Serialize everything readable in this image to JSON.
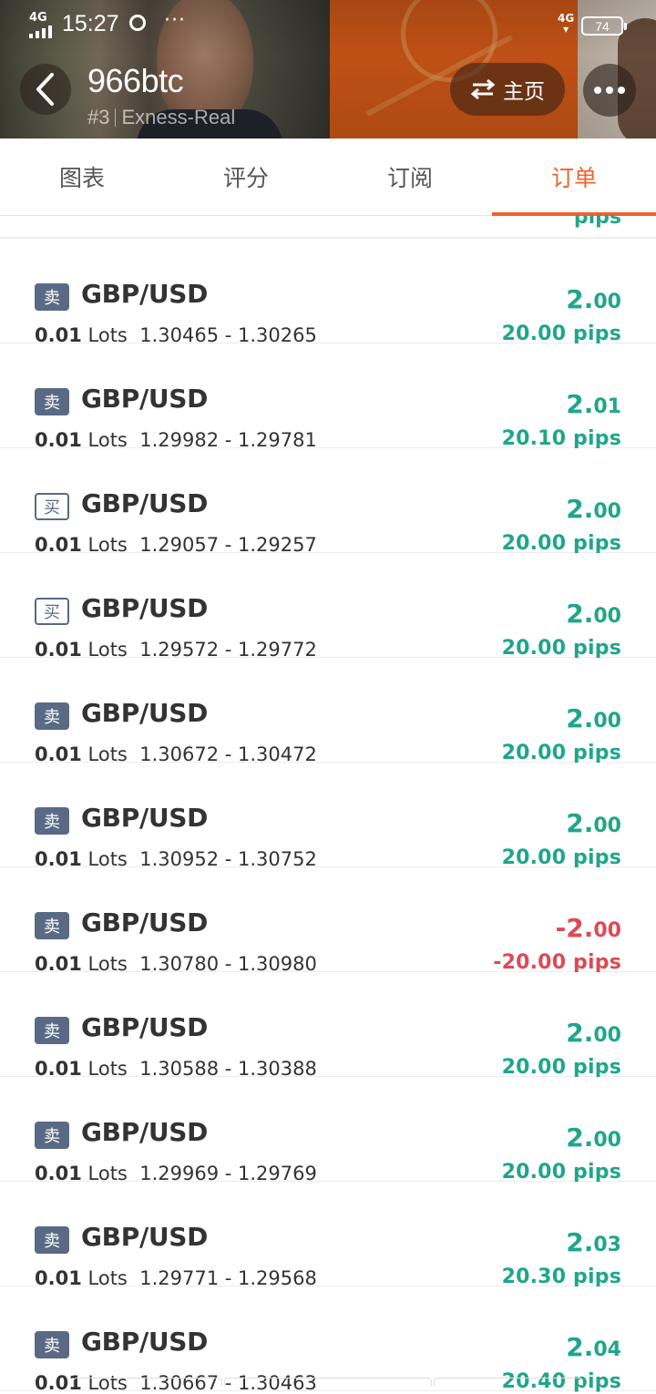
{
  "status_bar": {
    "network_left": "4G",
    "time": "15:27",
    "more": "···",
    "network_right": "4G",
    "battery": "74"
  },
  "header": {
    "account_name": "966btc",
    "account_rank": "#3",
    "account_server": "Exness-Real",
    "home_label": "主页"
  },
  "tabs": [
    {
      "label": "图表",
      "active": false
    },
    {
      "label": "评分",
      "active": false
    },
    {
      "label": "订阅",
      "active": false
    },
    {
      "label": "订单",
      "active": true
    }
  ],
  "partial_row": {
    "pips_fragment": "pips"
  },
  "orders": [
    {
      "side": "卖",
      "type": "sell",
      "symbol": "GBP/USD",
      "lots": "0.01",
      "lots_unit": "Lots",
      "open": "1.30465",
      "close": "1.30265",
      "profit_int": "2.",
      "profit_dec": "00",
      "pips": "20.00 pips",
      "negative": false
    },
    {
      "side": "卖",
      "type": "sell",
      "symbol": "GBP/USD",
      "lots": "0.01",
      "lots_unit": "Lots",
      "open": "1.29982",
      "close": "1.29781",
      "profit_int": "2.",
      "profit_dec": "01",
      "pips": "20.10 pips",
      "negative": false
    },
    {
      "side": "买",
      "type": "buy",
      "symbol": "GBP/USD",
      "lots": "0.01",
      "lots_unit": "Lots",
      "open": "1.29057",
      "close": "1.29257",
      "profit_int": "2.",
      "profit_dec": "00",
      "pips": "20.00 pips",
      "negative": false
    },
    {
      "side": "买",
      "type": "buy",
      "symbol": "GBP/USD",
      "lots": "0.01",
      "lots_unit": "Lots",
      "open": "1.29572",
      "close": "1.29772",
      "profit_int": "2.",
      "profit_dec": "00",
      "pips": "20.00 pips",
      "negative": false
    },
    {
      "side": "卖",
      "type": "sell",
      "symbol": "GBP/USD",
      "lots": "0.01",
      "lots_unit": "Lots",
      "open": "1.30672",
      "close": "1.30472",
      "profit_int": "2.",
      "profit_dec": "00",
      "pips": "20.00 pips",
      "negative": false
    },
    {
      "side": "卖",
      "type": "sell",
      "symbol": "GBP/USD",
      "lots": "0.01",
      "lots_unit": "Lots",
      "open": "1.30952",
      "close": "1.30752",
      "profit_int": "2.",
      "profit_dec": "00",
      "pips": "20.00 pips",
      "negative": false
    },
    {
      "side": "卖",
      "type": "sell",
      "symbol": "GBP/USD",
      "lots": "0.01",
      "lots_unit": "Lots",
      "open": "1.30780",
      "close": "1.30980",
      "profit_int": "-2.",
      "profit_dec": "00",
      "pips": "-20.00 pips",
      "negative": true
    },
    {
      "side": "卖",
      "type": "sell",
      "symbol": "GBP/USD",
      "lots": "0.01",
      "lots_unit": "Lots",
      "open": "1.30588",
      "close": "1.30388",
      "profit_int": "2.",
      "profit_dec": "00",
      "pips": "20.00 pips",
      "negative": false
    },
    {
      "side": "卖",
      "type": "sell",
      "symbol": "GBP/USD",
      "lots": "0.01",
      "lots_unit": "Lots",
      "open": "1.29969",
      "close": "1.29769",
      "profit_int": "2.",
      "profit_dec": "00",
      "pips": "20.00 pips",
      "negative": false
    },
    {
      "side": "卖",
      "type": "sell",
      "symbol": "GBP/USD",
      "lots": "0.01",
      "lots_unit": "Lots",
      "open": "1.29771",
      "close": "1.29568",
      "profit_int": "2.",
      "profit_dec": "03",
      "pips": "20.30 pips",
      "negative": false
    },
    {
      "side": "卖",
      "type": "sell",
      "symbol": "GBP/USD",
      "lots": "0.01",
      "lots_unit": "Lots",
      "open": "1.30667",
      "close": "1.30463",
      "profit_int": "2.",
      "profit_dec": "04",
      "pips": "20.40 pips",
      "negative": false
    }
  ],
  "colors": {
    "accent": "#f0622e",
    "profit_positive": "#1fa68a",
    "profit_negative": "#dc4a55",
    "badge": "#5a6a85"
  },
  "icons": {
    "back": "chevron-left-icon",
    "swap": "swap-arrows-icon",
    "more": "more-dots-icon"
  }
}
